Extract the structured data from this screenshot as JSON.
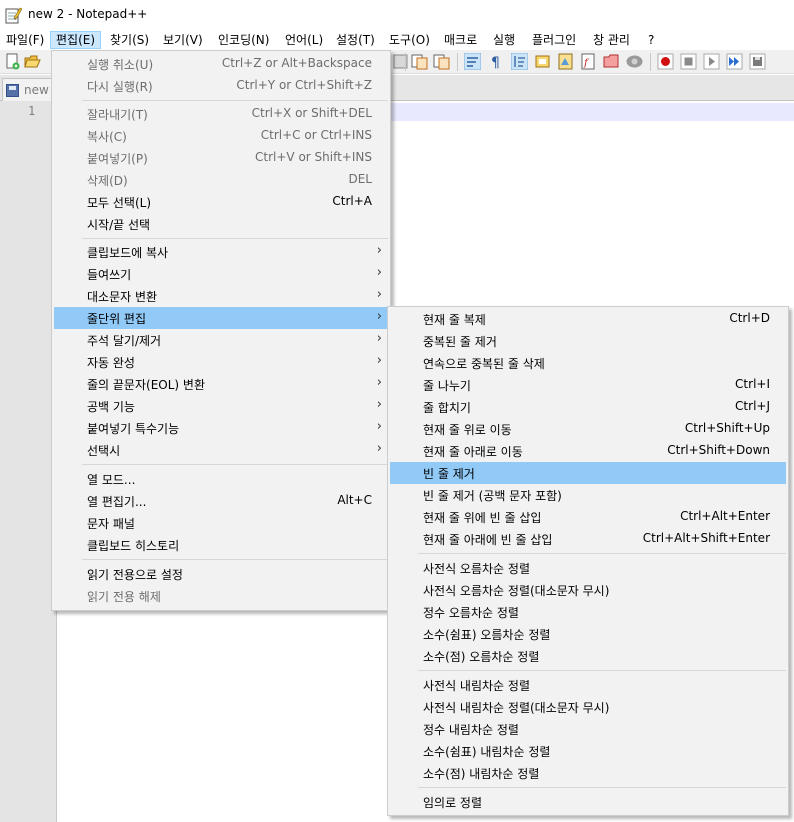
{
  "window": {
    "title": "new 2 - Notepad++"
  },
  "menubar": {
    "items": [
      {
        "label": "파일(F)"
      },
      {
        "label": "편집(E)"
      },
      {
        "label": "찾기(S)"
      },
      {
        "label": "보기(V)"
      },
      {
        "label": "인코딩(N)"
      },
      {
        "label": "언어(L)"
      },
      {
        "label": "설정(T)"
      },
      {
        "label": "도구(O)"
      },
      {
        "label": "매크로"
      },
      {
        "label": "실행"
      },
      {
        "label": "플러그인"
      },
      {
        "label": "창 관리"
      },
      {
        "label": "?"
      }
    ]
  },
  "tab": {
    "label": "new"
  },
  "editor": {
    "line_number": "1"
  },
  "edit_menu": {
    "items": [
      {
        "label": "실행 취소(U)",
        "shortcut": "Ctrl+Z or Alt+Backspace"
      },
      {
        "label": "다시 실행(R)",
        "shortcut": "Ctrl+Y or Ctrl+Shift+Z"
      },
      {
        "label": "잘라내기(T)",
        "shortcut": "Ctrl+X or Shift+DEL"
      },
      {
        "label": "복사(C)",
        "shortcut": "Ctrl+C or Ctrl+INS"
      },
      {
        "label": "붙여넣기(P)",
        "shortcut": "Ctrl+V or Shift+INS"
      },
      {
        "label": "삭제(D)",
        "shortcut": "DEL"
      },
      {
        "label": "모두 선택(L)",
        "shortcut": "Ctrl+A"
      },
      {
        "label": "시작/끝 선택",
        "shortcut": ""
      },
      {
        "label": "클립보드에 복사",
        "shortcut": ""
      },
      {
        "label": "들여쓰기",
        "shortcut": ""
      },
      {
        "label": "대소문자 변환",
        "shortcut": ""
      },
      {
        "label": "줄단위 편집",
        "shortcut": ""
      },
      {
        "label": "주석 달기/제거",
        "shortcut": ""
      },
      {
        "label": "자동 완성",
        "shortcut": ""
      },
      {
        "label": "줄의 끝문자(EOL) 변환",
        "shortcut": ""
      },
      {
        "label": "공백 기능",
        "shortcut": ""
      },
      {
        "label": "붙여넣기 특수기능",
        "shortcut": ""
      },
      {
        "label": "선택시",
        "shortcut": ""
      },
      {
        "label": "열 모드...",
        "shortcut": ""
      },
      {
        "label": "열 편집기...",
        "shortcut": "Alt+C"
      },
      {
        "label": "문자 패널",
        "shortcut": ""
      },
      {
        "label": "클립보드 히스토리",
        "shortcut": ""
      },
      {
        "label": "읽기 전용으로 설정",
        "shortcut": ""
      },
      {
        "label": "읽기 전용 해제",
        "shortcut": ""
      }
    ]
  },
  "line_ops_submenu": {
    "items": [
      {
        "label": "현재 줄 복제",
        "shortcut": "Ctrl+D"
      },
      {
        "label": "중복된 줄 제거",
        "shortcut": ""
      },
      {
        "label": "연속으로 중복된 줄 삭제",
        "shortcut": ""
      },
      {
        "label": "줄 나누기",
        "shortcut": "Ctrl+I"
      },
      {
        "label": "줄 합치기",
        "shortcut": "Ctrl+J"
      },
      {
        "label": "현재 줄 위로 이동",
        "shortcut": "Ctrl+Shift+Up"
      },
      {
        "label": "현재 줄 아래로 이동",
        "shortcut": "Ctrl+Shift+Down"
      },
      {
        "label": "빈 줄 제거",
        "shortcut": ""
      },
      {
        "label": "빈 줄 제거 (공백 문자 포함)",
        "shortcut": ""
      },
      {
        "label": "현재 줄 위에 빈 줄 삽입",
        "shortcut": "Ctrl+Alt+Enter"
      },
      {
        "label": "현재 줄 아래에 빈 줄 삽입",
        "shortcut": "Ctrl+Alt+Shift+Enter"
      },
      {
        "label": "사전식 오름차순 정렬",
        "shortcut": ""
      },
      {
        "label": "사전식 오름차순 정렬(대소문자 무시)",
        "shortcut": ""
      },
      {
        "label": "정수 오름차순 정렬",
        "shortcut": ""
      },
      {
        "label": "소수(쉼표) 오름차순 정렬",
        "shortcut": ""
      },
      {
        "label": "소수(점) 오름차순 정렬",
        "shortcut": ""
      },
      {
        "label": "사전식 내림차순 정렬",
        "shortcut": ""
      },
      {
        "label": "사전식 내림차순 정렬(대소문자 무시)",
        "shortcut": ""
      },
      {
        "label": "정수 내림차순 정렬",
        "shortcut": ""
      },
      {
        "label": "소수(쉼표) 내림차순 정렬",
        "shortcut": ""
      },
      {
        "label": "소수(점) 내림차순 정렬",
        "shortcut": ""
      },
      {
        "label": "임의로 정렬",
        "shortcut": ""
      }
    ]
  },
  "colors": {
    "menu_highlight": "#91c9f7",
    "menubar_active": "#cce8ff",
    "menu_background": "#f2f2f2",
    "disabled_text": "#6d6d6d",
    "current_line": "#e8e8ff",
    "gutter": "#e4e4e4"
  }
}
